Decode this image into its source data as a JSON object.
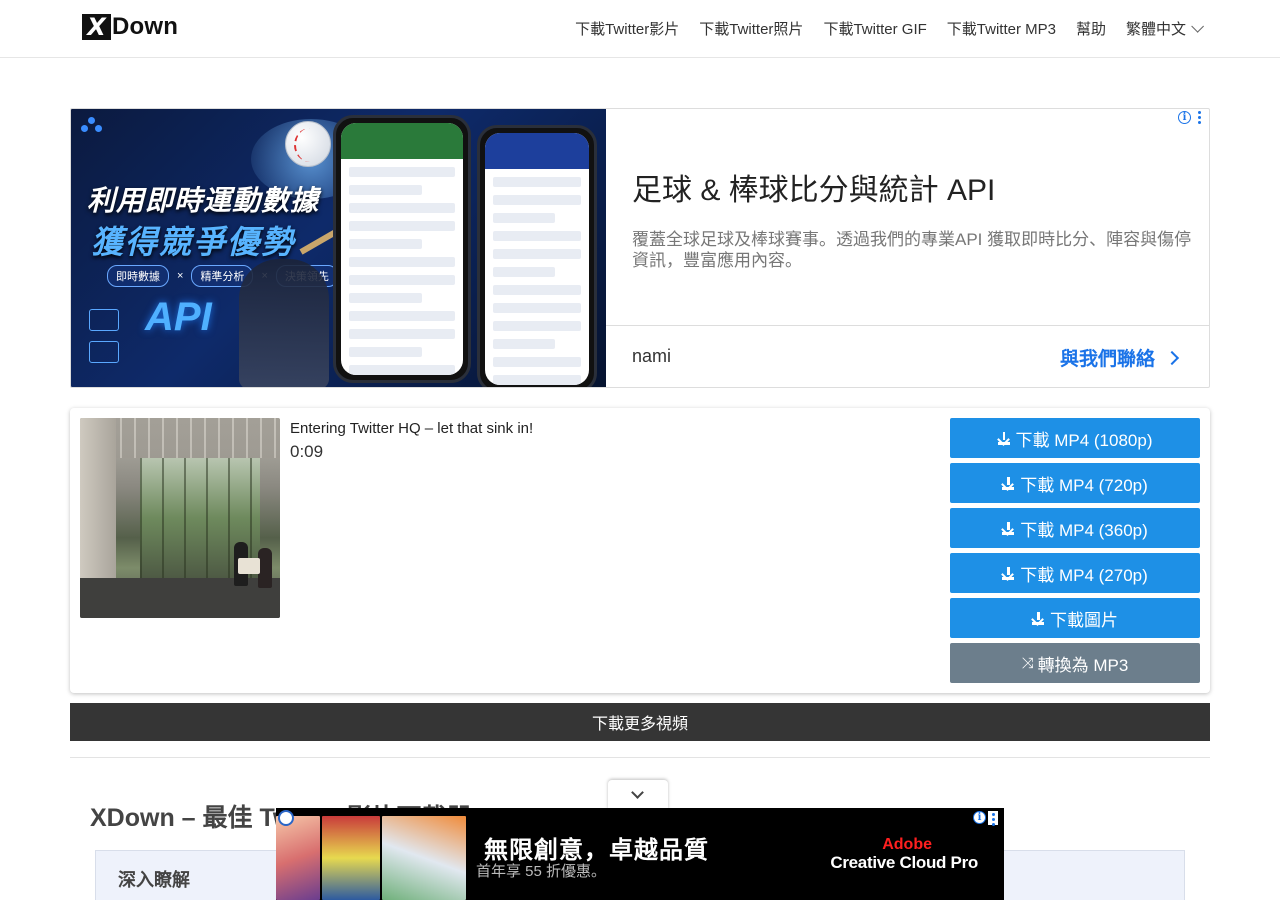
{
  "header": {
    "logo_x": "X",
    "logo_text": "Down",
    "nav": [
      {
        "label": "下載Twitter影片"
      },
      {
        "label": "下載Twitter照片"
      },
      {
        "label": "下載Twitter GIF"
      },
      {
        "label": "下載Twitter MP3"
      },
      {
        "label": "幫助"
      },
      {
        "label": "繁體中文"
      }
    ]
  },
  "ad_banner": {
    "image_line1": "利用即時運動數據",
    "image_line2": "獲得競爭優勢",
    "image_tags": [
      "即時數據",
      "精準分析",
      "決策領先"
    ],
    "image_api": "API",
    "title": "足球 & 棒球比分與統計 API",
    "description": "覆蓋全球足球及棒球賽事。透過我們的專業API 獲取即時比分、陣容與傷停資訊，豐富應用內容。",
    "brand": "nami",
    "cta": "與我們聯絡"
  },
  "result": {
    "title": "Entering Twitter HQ – let that sink in!",
    "duration": "0:09",
    "buttons": [
      {
        "label": "下載 MP4 (1080p)",
        "color": "#1e90e6"
      },
      {
        "label": "下載 MP4 (720p)",
        "color": "#1e90e6"
      },
      {
        "label": "下載 MP4 (360p)",
        "color": "#1e90e6"
      },
      {
        "label": "下載 MP4 (270p)",
        "color": "#1e90e6"
      },
      {
        "label": "下載圖片",
        "color": "#1e90e6"
      }
    ],
    "convert_label": "轉換為 MP3",
    "convert_color": "#6c7e8c"
  },
  "more_button": "下載更多視頻",
  "section": {
    "heading": "XDown – 最佳 Twitter 影片下載器",
    "panel_title": "深入瞭解"
  },
  "bottom_ad": {
    "headline": "無限創意，卓越品質",
    "sub": "首年享 55 折優惠。",
    "brand_line1": "Adobe",
    "brand_line2": "Creative Cloud Pro"
  }
}
